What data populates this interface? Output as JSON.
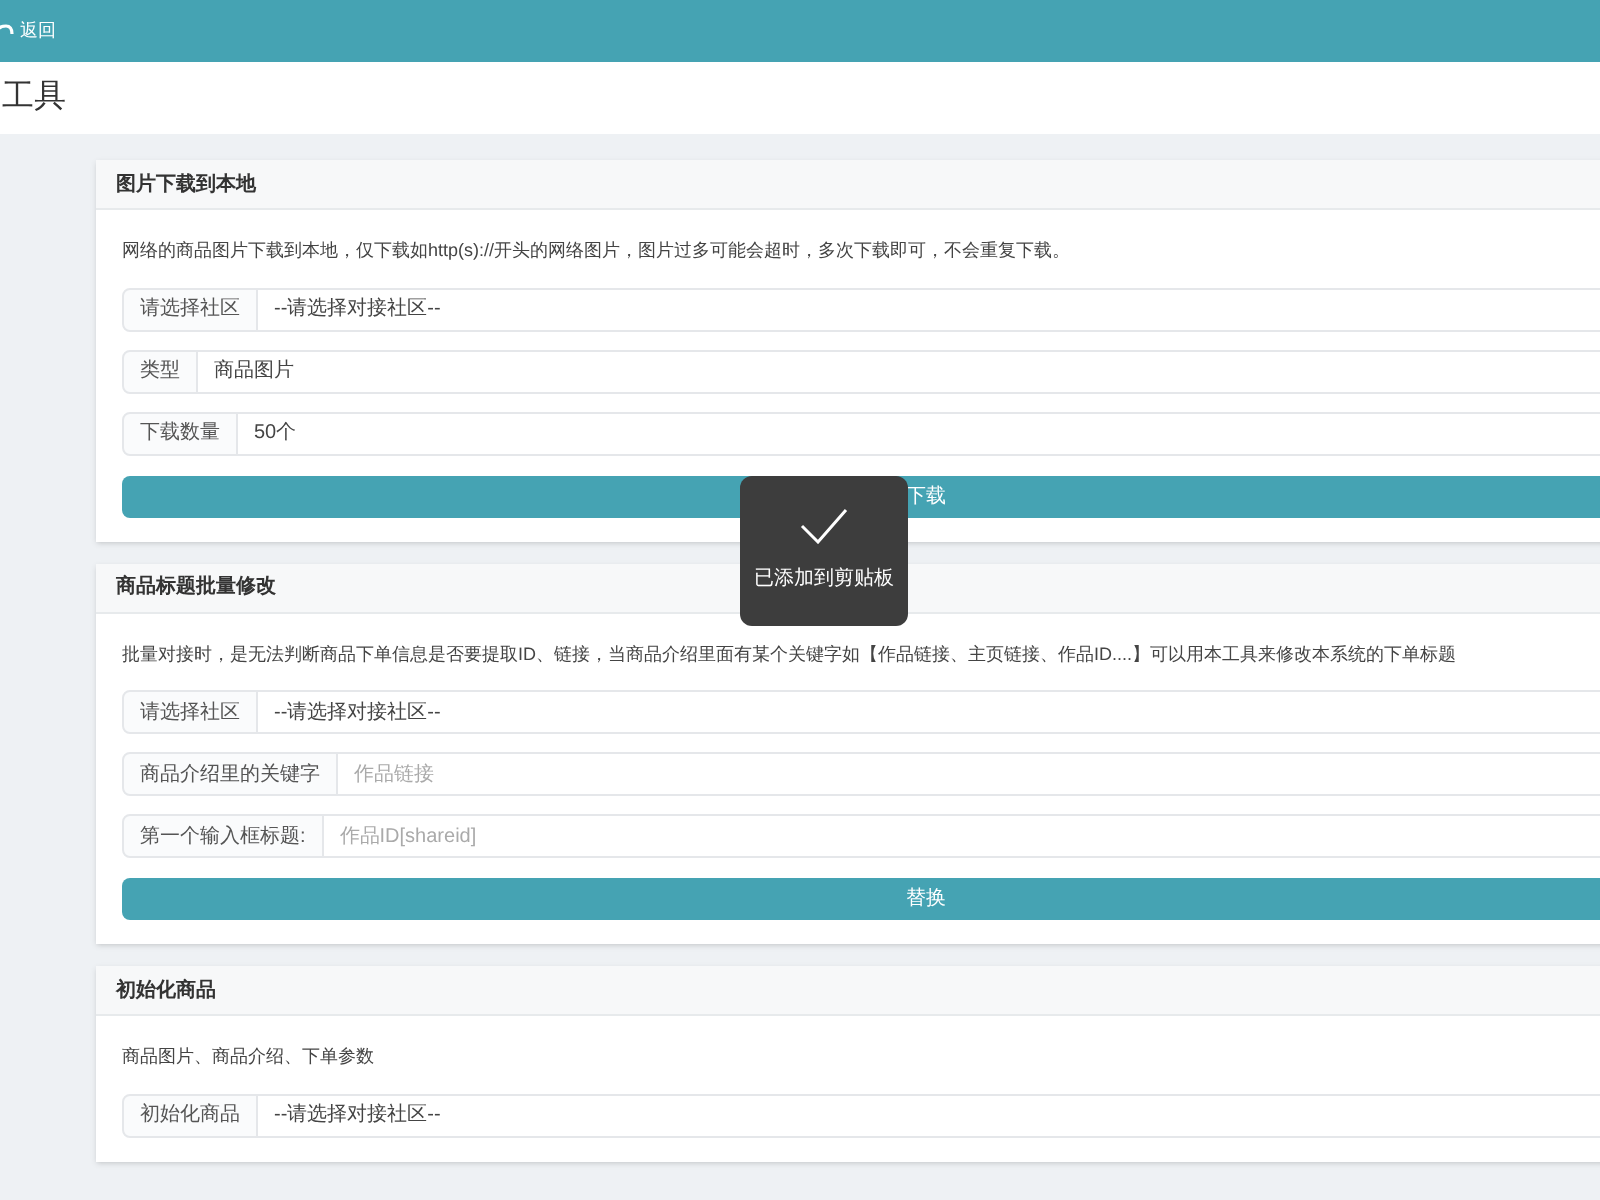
{
  "topbar": {
    "back": "返回"
  },
  "page_title": "工具",
  "cards": [
    {
      "title": "图片下载到本地",
      "description": "网络的商品图片下载到本地，仅下载如http(s)://开头的网络图片，图片过多可能会超时，多次下载即可，不会重复下载。",
      "fields": [
        {
          "label": "请选择社区",
          "kind": "select",
          "value": "--请选择对接社区--"
        },
        {
          "label": "类型",
          "kind": "select",
          "value": "商品图片"
        },
        {
          "label": "下载数量",
          "kind": "select",
          "value": "50个"
        }
      ],
      "button": "下载"
    },
    {
      "title": "商品标题批量修改",
      "description": "批量对接时，是无法判断商品下单信息是否要提取ID、链接，当商品介绍里面有某个关键字如【作品链接、主页链接、作品ID....】可以用本工具来修改本系统的下单标题",
      "fields": [
        {
          "label": "请选择社区",
          "kind": "select",
          "value": "--请选择对接社区--"
        },
        {
          "label": "商品介绍里的关键字",
          "kind": "input",
          "placeholder": "作品链接"
        },
        {
          "label": "第一个输入框标题:",
          "kind": "input",
          "placeholder": "作品ID[shareid]"
        }
      ],
      "button": "替换"
    },
    {
      "title": "初始化商品",
      "description": "商品图片、商品介绍、下单参数",
      "fields": [
        {
          "label": "初始化商品",
          "kind": "select",
          "value": "--请选择对接社区--"
        }
      ]
    }
  ],
  "toast": {
    "message": "已添加到剪贴板"
  }
}
